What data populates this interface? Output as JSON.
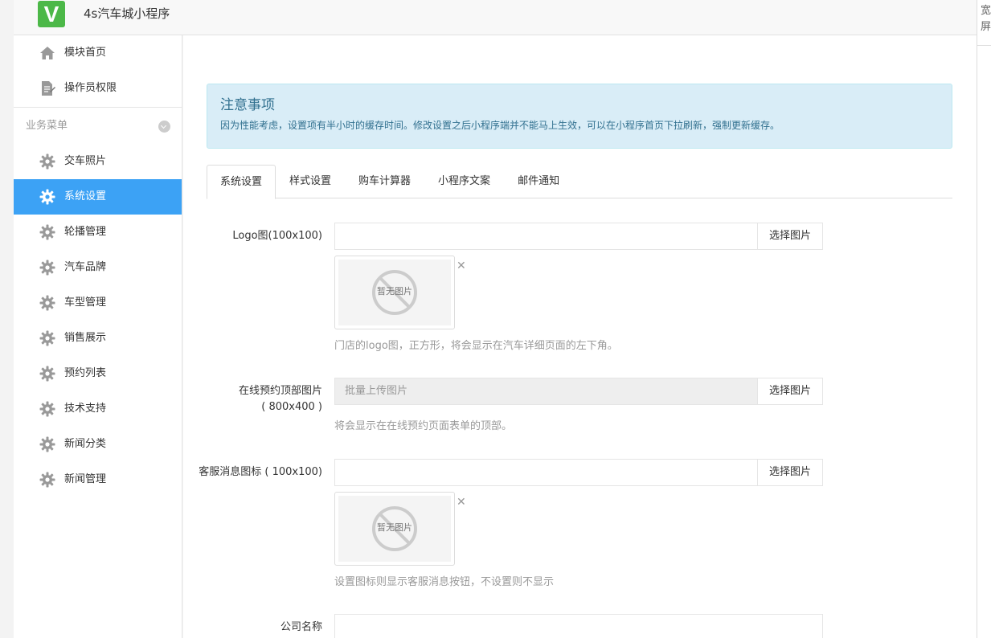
{
  "header": {
    "logo_letter": "V",
    "app_title": "4s汽车城小程序"
  },
  "right_strip": {
    "label": "宽屏"
  },
  "sidebar": {
    "top_items": [
      {
        "label": "模块首页",
        "icon": "home-icon"
      },
      {
        "label": "操作员权限",
        "icon": "document-icon"
      }
    ],
    "group": {
      "label": "业务菜单"
    },
    "items": [
      {
        "label": "交车照片",
        "icon": "gear-icon"
      },
      {
        "label": "系统设置",
        "icon": "gear-icon",
        "active": true
      },
      {
        "label": "轮播管理",
        "icon": "gear-icon"
      },
      {
        "label": "汽车品牌",
        "icon": "gear-icon"
      },
      {
        "label": "车型管理",
        "icon": "gear-icon"
      },
      {
        "label": "销售展示",
        "icon": "gear-icon"
      },
      {
        "label": "预约列表",
        "icon": "gear-icon"
      },
      {
        "label": "技术支持",
        "icon": "gear-icon"
      },
      {
        "label": "新闻分类",
        "icon": "gear-icon"
      },
      {
        "label": "新闻管理",
        "icon": "gear-icon"
      }
    ]
  },
  "notice": {
    "title": "注意事项",
    "text": "因为性能考虑，设置项有半小时的缓存时间。修改设置之后小程序端并不能马上生效，可以在小程序首页下拉刷新，强制更新缓存。"
  },
  "tabs": [
    "系统设置",
    "样式设置",
    "购车计算器",
    "小程序文案",
    "邮件通知"
  ],
  "form": {
    "logo": {
      "label": "Logo图(100x100)",
      "button": "选择图片",
      "placeholder_text": "暂无图片",
      "help": "门店的logo图，正方形，将会显示在汽车详细页面的左下角。"
    },
    "booking_top": {
      "label_line1": "在线预约顶部图片",
      "label_line2": "( 800x400 )",
      "input_text": "批量上传图片",
      "button": "选择图片",
      "help": "将会显示在在线预约页面表单的顶部。"
    },
    "service_icon": {
      "label": "客服消息图标 ( 100x100)",
      "button": "选择图片",
      "placeholder_text": "暂无图片",
      "help": "设置图标则显示客服消息按钮，不设置则不显示"
    },
    "company": {
      "label": "公司名称"
    }
  },
  "colors": {
    "accent": "#3ca2f5",
    "logo_green": "#4cb848",
    "notice_bg": "#d9edf7",
    "notice_text": "#31708f"
  }
}
